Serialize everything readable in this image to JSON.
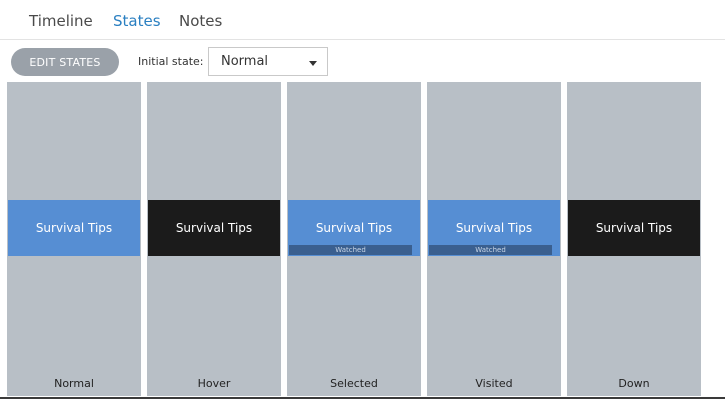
{
  "tabs": [
    {
      "label": "Timeline",
      "active": false
    },
    {
      "label": "States",
      "active": true
    },
    {
      "label": "Notes",
      "active": false
    }
  ],
  "toolbar": {
    "edit_states_label": "EDIT STATES",
    "initial_state_label": "Initial state:",
    "initial_state_value": "Normal"
  },
  "states": [
    {
      "name": "Normal",
      "button_text": "Survival Tips",
      "fill": "#568ed3",
      "badge": ""
    },
    {
      "name": "Hover",
      "button_text": "Survival Tips",
      "fill": "#1b1b1b",
      "badge": ""
    },
    {
      "name": "Selected",
      "button_text": "Survival Tips",
      "fill": "#568ed3",
      "badge": "Watched"
    },
    {
      "name": "Visited",
      "button_text": "Survival Tips",
      "fill": "#568ed3",
      "badge": "Watched"
    },
    {
      "name": "Down",
      "button_text": "Survival Tips",
      "fill": "#1b1b1b",
      "badge": ""
    }
  ],
  "colors": {
    "accent": "#2a7fc1",
    "panel_bg": "#b8bfc6",
    "edit_button_bg": "#9aa1a9"
  },
  "icons": {
    "select_caret": "caret-down-icon"
  }
}
